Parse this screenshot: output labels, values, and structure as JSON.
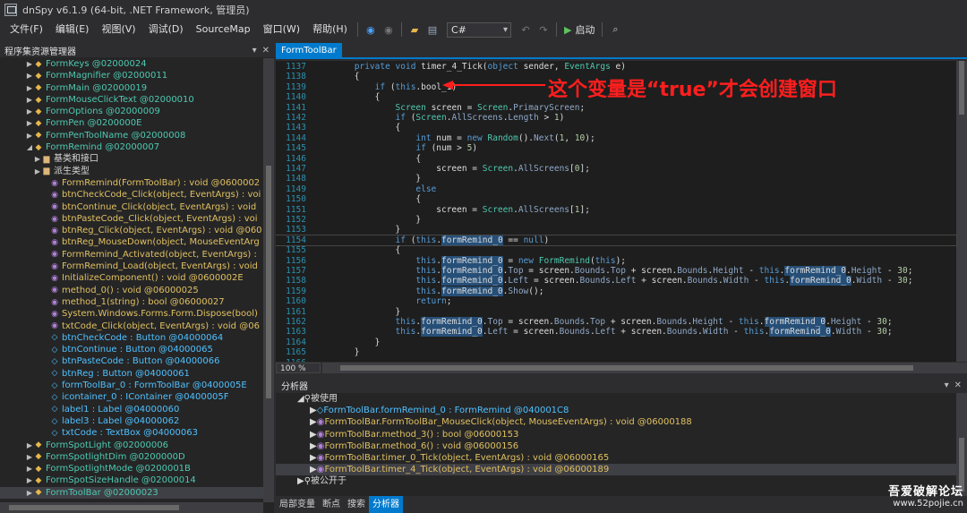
{
  "window": {
    "title": "dnSpy v6.1.9 (64-bit, .NET Framework, 管理员)"
  },
  "menu": [
    "文件(F)",
    "编辑(E)",
    "视图(V)",
    "调试(D)",
    "SourceMap",
    "窗口(W)",
    "帮助(H)"
  ],
  "toolbar": {
    "language": "C#",
    "start_label": "启动"
  },
  "explorer": {
    "title": "程序集资源管理器",
    "items": [
      {
        "depth": 3,
        "arrow": "▶",
        "kind": "type",
        "text": "FormKeys @02000024"
      },
      {
        "depth": 3,
        "arrow": "▶",
        "kind": "type",
        "text": "FormMagnifier @02000011"
      },
      {
        "depth": 3,
        "arrow": "▶",
        "kind": "type",
        "text": "FormMain @02000019"
      },
      {
        "depth": 3,
        "arrow": "▶",
        "kind": "type",
        "text": "FormMouseClickText @02000010"
      },
      {
        "depth": 3,
        "arrow": "▶",
        "kind": "type",
        "text": "FormOptions @02000009"
      },
      {
        "depth": 3,
        "arrow": "▶",
        "kind": "type",
        "text": "FormPen @0200000E"
      },
      {
        "depth": 3,
        "arrow": "▶",
        "kind": "type",
        "text": "FormPenToolName @02000008"
      },
      {
        "depth": 3,
        "arrow": "◢",
        "kind": "type",
        "text": "FormRemind @02000007"
      },
      {
        "depth": 4,
        "arrow": "▶",
        "kind": "folder",
        "text": "基类和接口"
      },
      {
        "depth": 4,
        "arrow": "▶",
        "kind": "folder",
        "text": "派生类型"
      },
      {
        "depth": 5,
        "arrow": "",
        "kind": "meth",
        "text": "FormRemind(FormToolBar) : void @0600002"
      },
      {
        "depth": 5,
        "arrow": "",
        "kind": "meth",
        "text": "btnCheckCode_Click(object, EventArgs) : voi"
      },
      {
        "depth": 5,
        "arrow": "",
        "kind": "meth",
        "text": "btnContinue_Click(object, EventArgs) : void"
      },
      {
        "depth": 5,
        "arrow": "",
        "kind": "meth",
        "text": "btnPasteCode_Click(object, EventArgs) : voi"
      },
      {
        "depth": 5,
        "arrow": "",
        "kind": "meth",
        "text": "btnReg_Click(object, EventArgs) : void @060"
      },
      {
        "depth": 5,
        "arrow": "",
        "kind": "meth",
        "text": "btnReg_MouseDown(object, MouseEventArg"
      },
      {
        "depth": 5,
        "arrow": "",
        "kind": "meth",
        "text": "FormRemind_Activated(object, EventArgs) :"
      },
      {
        "depth": 5,
        "arrow": "",
        "kind": "meth",
        "text": "FormRemind_Load(object, EventArgs) : void"
      },
      {
        "depth": 5,
        "arrow": "",
        "kind": "meth",
        "text": "InitializeComponent() : void @0600002E"
      },
      {
        "depth": 5,
        "arrow": "",
        "kind": "meth",
        "text": "method_0() : void @06000025"
      },
      {
        "depth": 5,
        "arrow": "",
        "kind": "meth",
        "text": "method_1(string) : bool @06000027"
      },
      {
        "depth": 5,
        "arrow": "",
        "kind": "meth",
        "text": "System.Windows.Forms.Form.Dispose(bool)"
      },
      {
        "depth": 5,
        "arrow": "",
        "kind": "meth",
        "text": "txtCode_Click(object, EventArgs) : void @06"
      },
      {
        "depth": 5,
        "arrow": "",
        "kind": "fld",
        "text": "btnCheckCode : Button @04000064"
      },
      {
        "depth": 5,
        "arrow": "",
        "kind": "fld",
        "text": "btnContinue : Button @04000065"
      },
      {
        "depth": 5,
        "arrow": "",
        "kind": "fld",
        "text": "btnPasteCode : Button @04000066"
      },
      {
        "depth": 5,
        "arrow": "",
        "kind": "fld",
        "text": "btnReg : Button @04000061"
      },
      {
        "depth": 5,
        "arrow": "",
        "kind": "fld",
        "text": "formToolBar_0 : FormToolBar @0400005E"
      },
      {
        "depth": 5,
        "arrow": "",
        "kind": "fld",
        "text": "icontainer_0 : IContainer @0400005F"
      },
      {
        "depth": 5,
        "arrow": "",
        "kind": "fld",
        "text": "label1 : Label @04000060"
      },
      {
        "depth": 5,
        "arrow": "",
        "kind": "fld",
        "text": "label3 : Label @04000062"
      },
      {
        "depth": 5,
        "arrow": "",
        "kind": "fld",
        "text": "txtCode : TextBox @04000063"
      },
      {
        "depth": 3,
        "arrow": "▶",
        "kind": "type",
        "text": "FormSpotLight @02000006"
      },
      {
        "depth": 3,
        "arrow": "▶",
        "kind": "type",
        "text": "FormSpotlightDim @0200000D"
      },
      {
        "depth": 3,
        "arrow": "▶",
        "kind": "type",
        "text": "FormSpotlightMode @0200001B"
      },
      {
        "depth": 3,
        "arrow": "▶",
        "kind": "type",
        "text": "FormSpotSizeHandle @02000014"
      },
      {
        "depth": 3,
        "arrow": "▶",
        "kind": "type",
        "text": "FormToolBar @02000023",
        "selected": true
      }
    ]
  },
  "editor": {
    "tab": "FormToolBar",
    "zoom": "100 %",
    "lines": [
      {
        "n": "1137",
        "code": "        private void timer_4_Tick(object sender, EventArgs e)"
      },
      {
        "n": "1138",
        "code": "        {"
      },
      {
        "n": "1139",
        "code": "            if (this.bool_1)"
      },
      {
        "n": "1140",
        "code": "            {"
      },
      {
        "n": "1141",
        "code": "                Screen screen = Screen.PrimaryScreen;"
      },
      {
        "n": "1142",
        "code": "                if (Screen.AllScreens.Length > 1)"
      },
      {
        "n": "1143",
        "code": "                {"
      },
      {
        "n": "1144",
        "code": "                    int num = new Random().Next(1, 10);"
      },
      {
        "n": "1145",
        "code": "                    if (num > 5)"
      },
      {
        "n": "1146",
        "code": "                    {"
      },
      {
        "n": "1147",
        "code": "                        screen = Screen.AllScreens[0];"
      },
      {
        "n": "1148",
        "code": "                    }"
      },
      {
        "n": "1149",
        "code": "                    else"
      },
      {
        "n": "1150",
        "code": "                    {"
      },
      {
        "n": "1151",
        "code": "                        screen = Screen.AllScreens[1];"
      },
      {
        "n": "1152",
        "code": "                    }"
      },
      {
        "n": "1153",
        "code": "                }"
      },
      {
        "n": "1154",
        "code": "                if (this.formRemind_0 == null)",
        "current": true
      },
      {
        "n": "1155",
        "code": "                {"
      },
      {
        "n": "1156",
        "code": "                    this.formRemind_0 = new FormRemind(this);"
      },
      {
        "n": "1157",
        "code": "                    this.formRemind_0.Top = screen.Bounds.Top + screen.Bounds.Height - this.formRemind_0.Height - 30;"
      },
      {
        "n": "1158",
        "code": "                    this.formRemind_0.Left = screen.Bounds.Left + screen.Bounds.Width - this.formRemind_0.Width - 30;"
      },
      {
        "n": "1159",
        "code": "                    this.formRemind_0.Show();"
      },
      {
        "n": "1160",
        "code": "                    return;"
      },
      {
        "n": "1161",
        "code": "                }"
      },
      {
        "n": "1162",
        "code": "                this.formRemind_0.Top = screen.Bounds.Top + screen.Bounds.Height - this.formRemind_0.Height - 30;"
      },
      {
        "n": "1163",
        "code": "                this.formRemind_0.Left = screen.Bounds.Left + screen.Bounds.Width - this.formRemind_0.Width - 30;"
      },
      {
        "n": "1164",
        "code": "            }"
      },
      {
        "n": "1165",
        "code": "        }"
      },
      {
        "n": "1166",
        "code": ""
      }
    ],
    "annotation": "这个变量是“true”才会创建窗口"
  },
  "analyzer": {
    "title": "分析器",
    "items": [
      {
        "depth": 1,
        "arrow": "◢",
        "text": "被使用",
        "kind": "ns"
      },
      {
        "depth": 2,
        "arrow": "▶",
        "text": "FormToolBar.formRemind_0 : FormRemind @040001C8",
        "kind": "fld"
      },
      {
        "depth": 2,
        "arrow": "▶",
        "text": "FormToolBar.FormToolBar_MouseClick(object, MouseEventArgs) : void @06000188",
        "kind": "meth"
      },
      {
        "depth": 2,
        "arrow": "▶",
        "text": "FormToolBar.method_3() : bool @06000153",
        "kind": "meth"
      },
      {
        "depth": 2,
        "arrow": "▶",
        "text": "FormToolBar.method_6() : void @06000156",
        "kind": "meth"
      },
      {
        "depth": 2,
        "arrow": "▶",
        "text": "FormToolBar.timer_0_Tick(object, EventArgs) : void @06000165",
        "kind": "meth"
      },
      {
        "depth": 2,
        "arrow": "▶",
        "text": "FormToolBar.timer_4_Tick(object, EventArgs) : void @06000189",
        "kind": "meth",
        "selected": true
      },
      {
        "depth": 1,
        "arrow": "▶",
        "text": "被公开于",
        "kind": "ns"
      }
    ]
  },
  "bottom_tabs": [
    "局部变量",
    "断点",
    "搜索",
    "分析器"
  ],
  "watermark": {
    "line1": "吾爱破解论坛",
    "line2": "www.52pojie.cn"
  }
}
